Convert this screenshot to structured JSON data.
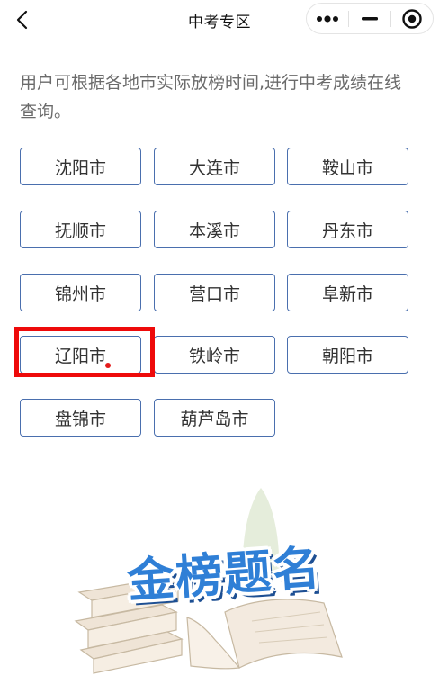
{
  "navbar": {
    "title": "中考专区",
    "back_icon": "chevron-left-icon",
    "more_icon": "more-dots-icon",
    "minimize_icon": "minimize-icon",
    "close_icon": "target-close-icon"
  },
  "intro": "用户可根据各地市实际放榜时间,进行中考成绩在线查询。",
  "cities": [
    "沈阳市",
    "大连市",
    "鞍山市",
    "抚顺市",
    "本溪市",
    "丹东市",
    "锦州市",
    "营口市",
    "阜新市",
    "辽阳市",
    "铁岭市",
    "朝阳市",
    "盘锦市",
    "葫芦岛市"
  ],
  "highlighted_city": "辽阳市",
  "banner": {
    "logo_text": "金榜题名",
    "colors": {
      "logo": "#2f7fd6",
      "logo_shadow": "#1d4f93",
      "highlight": "#ee0a0a",
      "button_border": "#4a6fae"
    }
  }
}
